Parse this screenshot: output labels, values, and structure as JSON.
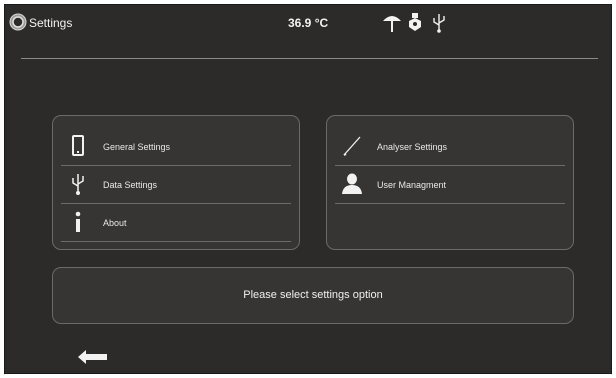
{
  "header": {
    "app_logo_icon": "power-ring-icon",
    "title": "Settings",
    "temperature": "36.9 °C",
    "status_icons": [
      "umbrella-icon",
      "nib-icon",
      "usb-icon"
    ]
  },
  "panels": {
    "left": {
      "items": [
        {
          "label": "General Settings",
          "icon": "phone-icon"
        },
        {
          "label": "Data Settings",
          "icon": "usb-icon"
        },
        {
          "label": "About",
          "icon": "info-icon"
        }
      ]
    },
    "right": {
      "items": [
        {
          "label": "Analyser Settings",
          "icon": "stylus-icon"
        },
        {
          "label": "User Managment",
          "icon": "user-icon"
        }
      ]
    }
  },
  "message": "Please select settings option",
  "back_icon": "arrow-left-icon",
  "colors": {
    "background": "#2c2b2a",
    "panel": "#363534",
    "panel_border": "#6a6a68",
    "text": "#f0f0f0"
  }
}
